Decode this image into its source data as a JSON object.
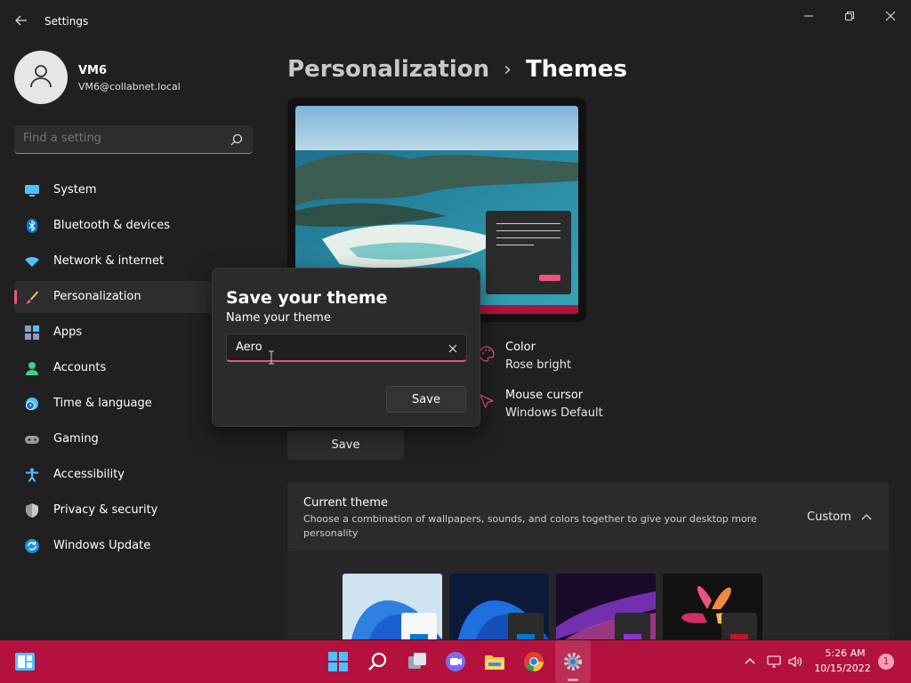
{
  "window": {
    "title": "Settings",
    "icons": {
      "back": "back-arrow-icon",
      "minimize": "minimize-icon",
      "maximize": "restore-icon",
      "close": "close-icon"
    }
  },
  "profile": {
    "name": "VM6",
    "email": "VM6@collabnet.local"
  },
  "search": {
    "placeholder": "Find a setting",
    "icon": "search-icon"
  },
  "sidebar": {
    "items": [
      {
        "label": "System",
        "icon": "system-icon",
        "active": false
      },
      {
        "label": "Bluetooth & devices",
        "icon": "bluetooth-icon",
        "active": false
      },
      {
        "label": "Network & internet",
        "icon": "wifi-icon",
        "active": false
      },
      {
        "label": "Personalization",
        "icon": "brush-icon",
        "active": true
      },
      {
        "label": "Apps",
        "icon": "apps-icon",
        "active": false
      },
      {
        "label": "Accounts",
        "icon": "accounts-icon",
        "active": false
      },
      {
        "label": "Time & language",
        "icon": "globe-clock-icon",
        "active": false
      },
      {
        "label": "Gaming",
        "icon": "gamepad-icon",
        "active": false
      },
      {
        "label": "Accessibility",
        "icon": "accessibility-icon",
        "active": false
      },
      {
        "label": "Privacy & security",
        "icon": "shield-icon",
        "active": false
      },
      {
        "label": "Windows Update",
        "icon": "update-icon",
        "active": false
      }
    ]
  },
  "breadcrumb": {
    "parent": "Personalization",
    "separator": "›",
    "current": "Themes"
  },
  "theme_props": {
    "color": {
      "title": "Color",
      "value": "Rose bright",
      "icon": "palette-icon"
    },
    "cursor": {
      "title": "Mouse cursor",
      "value": "Windows Default",
      "icon": "cursor-icon"
    }
  },
  "main_save_label": "Save",
  "current_theme": {
    "title": "Current theme",
    "description": "Choose a combination of wallpapers, sounds, and colors together to give your desktop more personality",
    "value": "Custom",
    "chevron_icon": "chevron-up-icon",
    "thumbnails": [
      "windows-light-theme",
      "windows-dark-theme",
      "glow-theme",
      "captured-motion-theme"
    ]
  },
  "dialog": {
    "title": "Save your theme",
    "label": "Name your theme",
    "input_value": "Aero",
    "clear_icon": "clear-x-icon",
    "save_label": "Save"
  },
  "taskbar": {
    "apps": [
      "start-icon",
      "search-icon",
      "task-view-icon",
      "chat-icon",
      "file-explorer-icon",
      "chrome-icon",
      "settings-icon"
    ],
    "tray": [
      "chevron-up-icon",
      "network-icon",
      "volume-icon"
    ],
    "time": "5:26 AM",
    "date": "10/15/2022",
    "notifications": "1"
  },
  "colors": {
    "accent": "#e8557d",
    "taskbar": "#b3123e",
    "background": "#202020",
    "card": "#2b2b2b"
  }
}
